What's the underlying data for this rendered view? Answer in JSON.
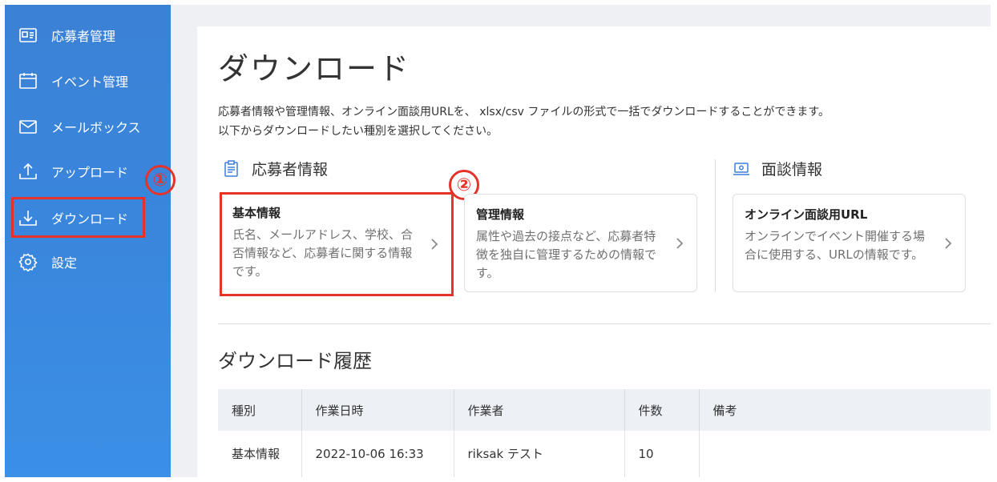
{
  "sidebar": {
    "items": [
      {
        "label": "応募者管理",
        "icon": "id-card-icon"
      },
      {
        "label": "イベント管理",
        "icon": "calendar-icon"
      },
      {
        "label": "メールボックス",
        "icon": "mail-icon"
      },
      {
        "label": "アップロード",
        "icon": "upload-icon"
      },
      {
        "label": "ダウンロード",
        "icon": "download-icon"
      },
      {
        "label": "設定",
        "icon": "gear-icon"
      }
    ]
  },
  "markers": {
    "one": "①",
    "two": "②"
  },
  "page": {
    "title": "ダウンロード",
    "desc_line1": "応募者情報や管理情報、オンライン面談用URLを、 xlsx/csv ファイルの形式で一括でダウンロードすることができます。",
    "desc_line2": "以下からダウンロードしたい種別を選択してください。"
  },
  "sections": {
    "applicant": {
      "label": "応募者情報",
      "icon": "document-icon"
    },
    "interview": {
      "label": "面談情報",
      "icon": "laptop-icon"
    }
  },
  "cards": [
    {
      "title": "基本情報",
      "body": "氏名、メールアドレス、学校、合否情報など、応募者に関する情報です。"
    },
    {
      "title": "管理情報",
      "body": "属性や過去の接点など、応募者特徴を独自に管理するための情報です。"
    },
    {
      "title": "オンライン面談用URL",
      "body": "オンラインでイベント開催する場合に使用する、URLの情報です。"
    }
  ],
  "history": {
    "title": "ダウンロード履歴",
    "columns": [
      "種別",
      "作業日時",
      "作業者",
      "件数",
      "備考"
    ],
    "rows": [
      [
        "基本情報",
        "2022-10-06 16:33",
        "riksak テスト",
        "10",
        ""
      ]
    ]
  },
  "colors": {
    "sidebar": "#3b86dc",
    "highlight": "#e5332a"
  }
}
